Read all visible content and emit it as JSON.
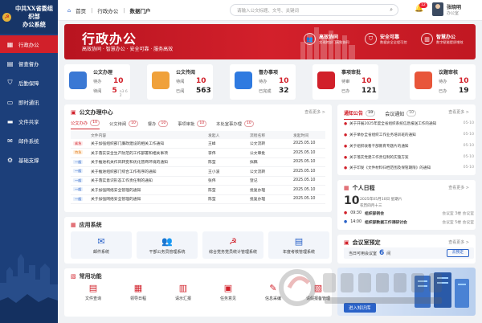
{
  "sidebar": {
    "logo_line1": "中共XX省委组织部",
    "logo_line2": "办公系统",
    "items": [
      {
        "label": "行政办公",
        "icon": "grid-icon",
        "active": true
      },
      {
        "label": "督查督办",
        "icon": "clipboard-icon"
      },
      {
        "label": "后勤保障",
        "icon": "shield-icon"
      },
      {
        "label": "即时通讯",
        "icon": "chat-icon"
      },
      {
        "label": "文件共享",
        "icon": "folder-icon"
      },
      {
        "label": "邮件系统",
        "icon": "mail-icon"
      },
      {
        "label": "基础支撑",
        "icon": "settings-icon"
      }
    ]
  },
  "header": {
    "breadcrumb": [
      "首页",
      "行政办公",
      "数据门户"
    ],
    "search_placeholder": "请输入公文标题、文号、关键词",
    "notif_count": "12",
    "user_name": "张晓明",
    "user_role": "办公室"
  },
  "banner": {
    "title": "行政办公",
    "subtitle": "高效协同 · 智慧办公 · 安全可靠 · 服务高效",
    "features": [
      {
        "title": "高效协同",
        "sub": "实现跨部门高效协同"
      },
      {
        "title": "安全可靠",
        "sub": "数据安全全程可控"
      },
      {
        "title": "智慧办公",
        "sub": "数字赋能提质增效"
      }
    ]
  },
  "stats": [
    {
      "name": "公文办理",
      "l1": "待办",
      "v1": "10",
      "l2": "待阅",
      "v2": "5",
      "extra": "n3 6 2"
    },
    {
      "name": "公文传阅",
      "l1": "待阅",
      "v1": "10",
      "l2": "已阅",
      "v2": "563"
    },
    {
      "name": "督办事项",
      "l1": "待办",
      "v1": "10",
      "l2": "已完成",
      "v2": "32"
    },
    {
      "name": "事项审批",
      "l1": "待审",
      "v1": "10",
      "l2": "已办",
      "v2": "121"
    },
    {
      "name": "议题审核",
      "l1": "待办",
      "v1": "10",
      "l2": "已办",
      "v2": "19"
    }
  ],
  "center": {
    "title": "公文办理中心",
    "more": "查看更多 >",
    "tabs": [
      {
        "label": "公文办办",
        "count": "10"
      },
      {
        "label": "公文待阅",
        "count": "10"
      },
      {
        "label": "督办",
        "count": "10"
      },
      {
        "label": "事项审批",
        "count": "10"
      },
      {
        "label": "本处室事办理",
        "count": "10"
      }
    ],
    "columns": [
      "",
      "文件内容",
      "发起人",
      "流程名称",
      "发起时间"
    ],
    "rows": [
      {
        "pri": "紧急",
        "title": "关于加强组织部门廉政建设的相关工作通知",
        "sender": "王峰",
        "flow": "公文流转",
        "date": "2025.05.10"
      },
      {
        "pri": "特急",
        "title": "关于落实安全生产防范的工作部署和相关事项",
        "sender": "李伟",
        "flow": "公文审批",
        "date": "2025.05.10"
      },
      {
        "pri": "一般",
        "title": "关于推进机关作风转变和优化营商环境的通知",
        "sender": "陈莹",
        "flow": "拟稿",
        "date": "2025.05.10"
      },
      {
        "pri": "一般",
        "title": "关于推进组织部门综合工作有序的通知",
        "sender": "王小波",
        "flow": "公文流转",
        "date": "2025.05.10"
      },
      {
        "pri": "一般",
        "title": "关于落实意识形态工作责任制的通知",
        "sender": "张伟",
        "flow": "登记",
        "date": "2025.05.10"
      },
      {
        "pri": "一般",
        "title": "关于加强网络安全管理的通知",
        "sender": "陈莹",
        "flow": "批复办理",
        "date": "2025.05.10"
      },
      {
        "pri": "一般",
        "title": "关于加强网络安全管理的通知",
        "sender": "陈莹",
        "flow": "批复办理",
        "date": "2025.05.10"
      }
    ]
  },
  "apps": {
    "title": "应用系统",
    "items": [
      {
        "label": "邮件系统",
        "icon": "mail-icon"
      },
      {
        "label": "干部公务员管理系统",
        "icon": "people-icon"
      },
      {
        "label": "综合党务党员统计管理系统",
        "icon": "party-emblem-icon"
      },
      {
        "label": "年度考核管理系统",
        "icon": "checklist-icon"
      }
    ]
  },
  "tools": {
    "title": "常用功能",
    "items": [
      "文件查询",
      "领导日程",
      "请示汇报",
      "任务意见",
      "信息采编",
      "请假报备管理"
    ]
  },
  "notices": {
    "tabs": [
      {
        "label": "通知公告",
        "count": "10"
      },
      {
        "label": "会议通知",
        "count": "10"
      }
    ],
    "more": "查看更多 >",
    "items": [
      {
        "text": "关于开展2025年度全省组织系统信息报送工作的通知",
        "date": "05-10"
      },
      {
        "text": "关于举办全省组织工作业务培训班的通知",
        "date": "05-10"
      },
      {
        "text": "关于组织收看干部教育专题片的通知",
        "date": "05-10"
      },
      {
        "text": "关于落实党建工作责任制的实施方案",
        "date": "05-10"
      },
      {
        "text": "关于印发《文件材料归档范围及保管期限》的通知",
        "date": "05-10"
      }
    ]
  },
  "schedule": {
    "title": "个人日程",
    "more": "查看更多 >",
    "day": "10",
    "date_text": "2025年05月10日 星期六",
    "week_text": "农历四月十三",
    "events": [
      {
        "time": "09:30",
        "title": "组织部例会",
        "place": "会议室 3楼 会议室"
      },
      {
        "time": "14:00",
        "title": "组织部数据工作调研讨会",
        "place": "会议室 5楼 会议室"
      }
    ]
  },
  "meeting": {
    "title": "会议室预定",
    "more": "查看更多 >",
    "label": "当日可用会议室",
    "count": "6",
    "unit": "间",
    "button": "去预定"
  },
  "promo": {
    "button": "进入知识库"
  },
  "colors": {
    "brand_red": "#d1202a",
    "sidebar_blue": "#1c3f7a",
    "accent_blue": "#2a62c8"
  }
}
